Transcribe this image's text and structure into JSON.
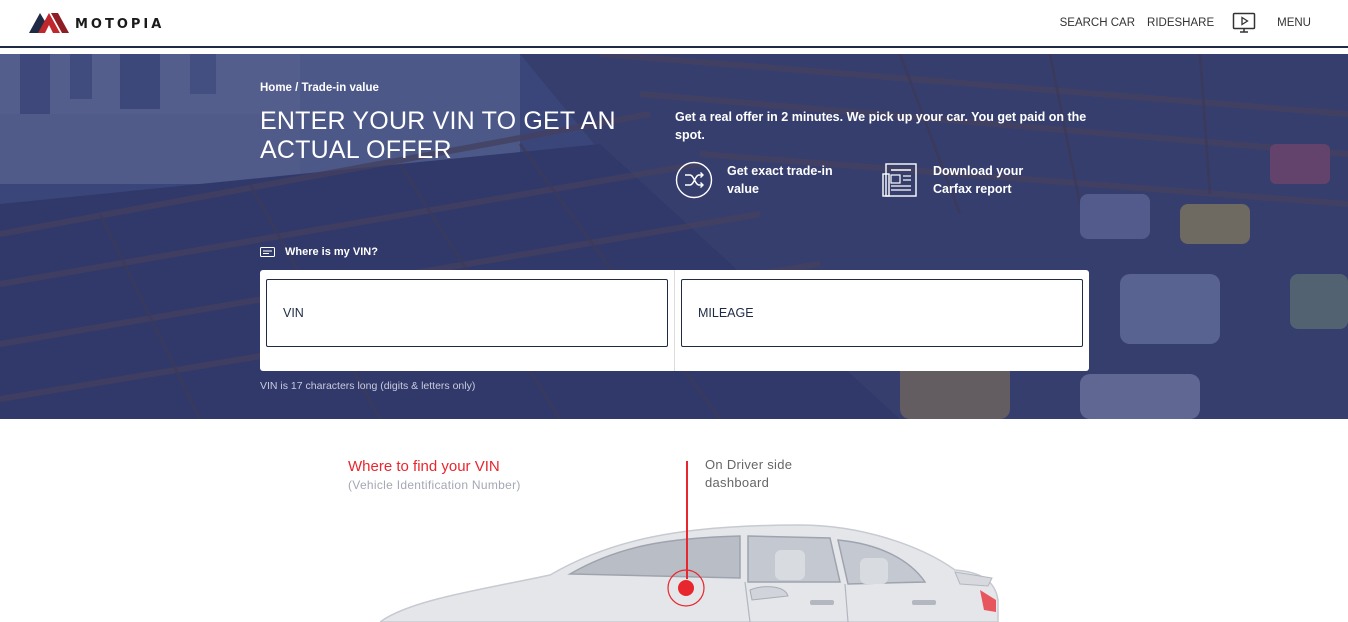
{
  "header": {
    "brand": "MOTOPIA",
    "nav": {
      "search_car": "SEARCH CAR",
      "rideshare": "RIDESHARE",
      "menu": "MENU"
    }
  },
  "hero": {
    "breadcrumb": "Home / Trade-in value",
    "title": "ENTER YOUR VIN TO GET AN ACTUAL OFFER",
    "subtitle": "Get a real offer in 2 minutes. We pick up your car. You get paid on the spot.",
    "features": [
      {
        "icon": "shuffle-icon",
        "label": "Get exact trade-in value"
      },
      {
        "icon": "report-icon",
        "label": "Download your Carfax report"
      }
    ],
    "vin_help": "Where is my VIN?",
    "form": {
      "vin_placeholder": "VIN",
      "mileage_placeholder": "MILEAGE"
    },
    "vin_hint": "VIN is 17 characters long (digits & letters only)"
  },
  "vin_location": {
    "title": "Where to find your VIN",
    "subtitle": "(Vehicle Identification Number)",
    "note": "On Driver side dashboard"
  },
  "colors": {
    "accent_red": "#e8262d",
    "navy": "#1f2a44",
    "hero_overlay": "#242c68"
  }
}
